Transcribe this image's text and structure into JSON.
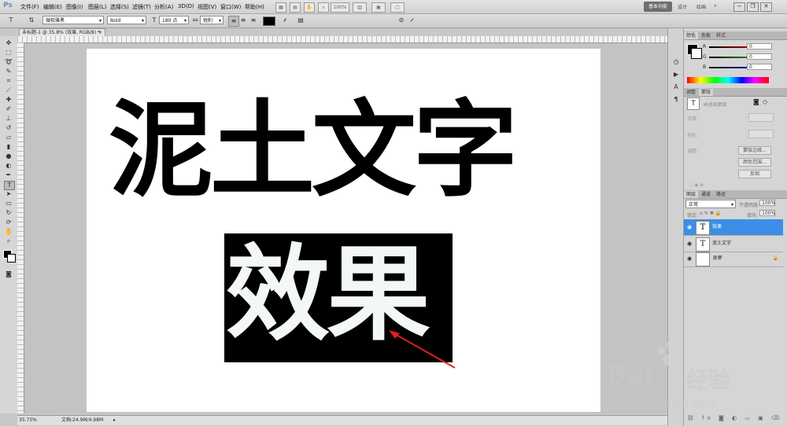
{
  "menubar": {
    "logo": "Ps",
    "items": [
      "文件(F)",
      "编辑(E)",
      "图像(I)",
      "图层(L)",
      "选择(S)",
      "滤镜(T)",
      "分析(A)",
      "3D(D)",
      "视图(V)",
      "窗口(W)",
      "帮助(H)"
    ],
    "zoom": "100%",
    "workspaces": [
      "基本功能",
      "设计",
      "绘画"
    ],
    "window_buttons": [
      "−",
      "❐",
      "✕"
    ]
  },
  "options": {
    "font_family": "微软雅黑",
    "font_style": "Bold",
    "size": "180 点",
    "antialias_label": "aa",
    "antialias": "锐利",
    "color": "#000000"
  },
  "document": {
    "tab_title": "未标题-1 @ 35.8% (效果, RGB/8) *",
    "close": "×",
    "line1": "泥土文字",
    "line2": "效果"
  },
  "status": {
    "zoom": "35.75%",
    "doc_info": "文档:24.9M/4.98M"
  },
  "color_panel": {
    "tabs": [
      "颜色",
      "色板",
      "样式"
    ],
    "r_label": "R",
    "g_label": "G",
    "b_label": "B",
    "r": "0",
    "g": "0",
    "b": "0"
  },
  "adjust_panel": {
    "tabs": [
      "调整",
      "蒙版"
    ],
    "type": "未选择蒙版",
    "density_label": "浓度:",
    "feather_label": "羽化:",
    "refine_label": "调整:",
    "buttons": [
      "蒙版边缘...",
      "颜色范围...",
      "反相"
    ]
  },
  "layers_panel": {
    "tabs": [
      "图层",
      "通道",
      "路径"
    ],
    "blend_mode": "正常",
    "opacity_label": "不透明度:",
    "opacity": "100%",
    "lock_label": "锁定:",
    "fill_label": "填充:",
    "fill": "100%",
    "layers": [
      {
        "name": "效果",
        "thumb": "T",
        "selected": true
      },
      {
        "name": "泥土文字",
        "thumb": "T",
        "selected": false
      },
      {
        "name": "背景",
        "thumb": "",
        "selected": false
      }
    ]
  },
  "watermark": {
    "brand": "Bai",
    "brand_suffix": "经验",
    "url": "jingyan.baidu.com"
  },
  "colors": {
    "accent": "#3d8ee6",
    "arrow": "#e02020"
  }
}
